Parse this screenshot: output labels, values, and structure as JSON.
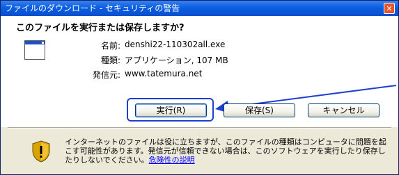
{
  "window": {
    "title": "ファイルのダウンロード - セキュリティの警告",
    "close_symbol": "✕"
  },
  "question": "このファイルを実行または保存しますか?",
  "file_info": {
    "name_label": "名前:",
    "name_value": "denshi22-110302all.exe",
    "type_label": "種類:",
    "type_value": "アプリケーション, 107 MB",
    "source_label": "発信元:",
    "source_value": "www.tatemura.net"
  },
  "buttons": {
    "run": "実行(R)",
    "save": "保存(S)",
    "cancel": "キャンセル"
  },
  "warning": {
    "text": "インターネットのファイルは役に立ちますが、このファイルの種類はコンピュータに問題を起こす可能性があります。発信元が信頼できない場合は、このソフトウェアを実行したり保存したりしないでください。",
    "link": "危険性の説明"
  },
  "colors": {
    "titlebar": "#0a5fe0",
    "annotation": "#1f3fd4",
    "link": "#0000ff"
  },
  "icons": {
    "file": "application-window-icon",
    "warning": "shield-icon"
  }
}
